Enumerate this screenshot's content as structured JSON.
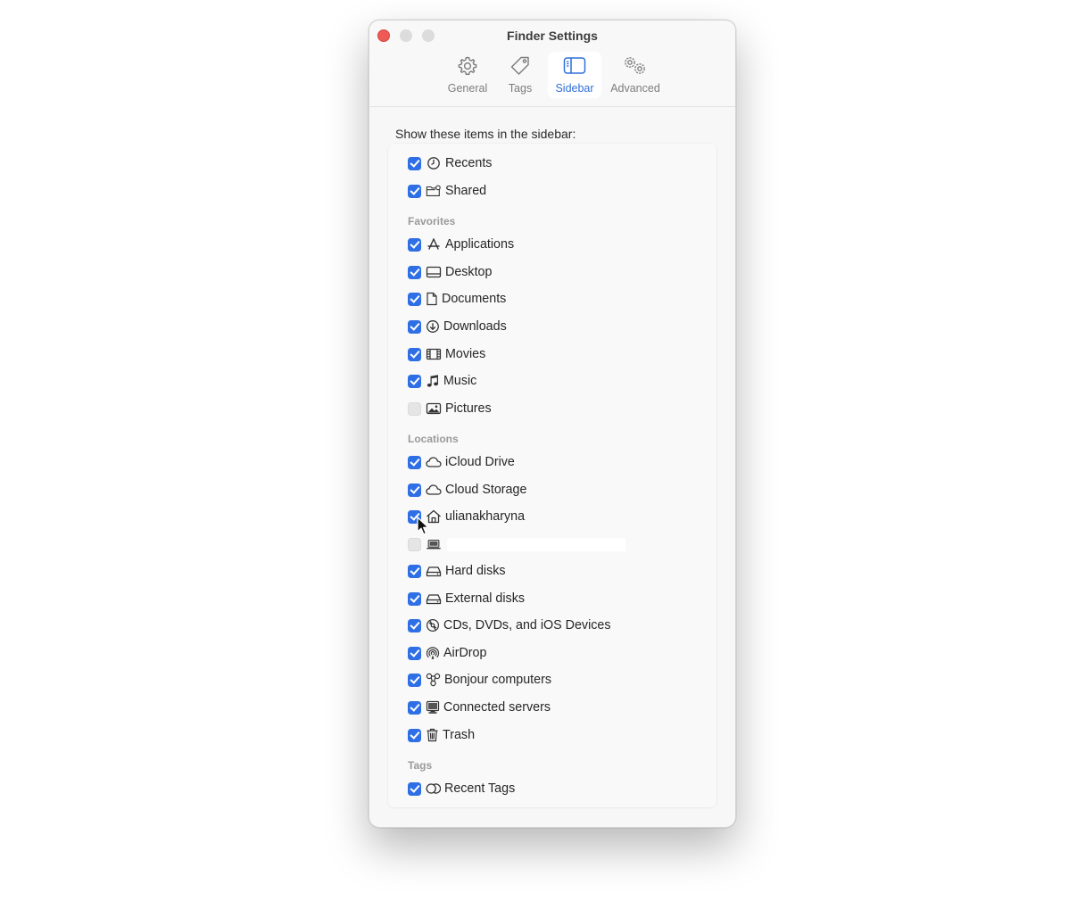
{
  "window": {
    "title": "Finder Settings"
  },
  "toolbar": {
    "tabs": [
      {
        "label": "General",
        "icon": "gear-icon"
      },
      {
        "label": "Tags",
        "icon": "tag-icon"
      },
      {
        "label": "Sidebar",
        "icon": "sidebar-icon",
        "selected": true
      },
      {
        "label": "Advanced",
        "icon": "gears-icon"
      }
    ]
  },
  "heading": "Show these items in the sidebar:",
  "top_items": [
    {
      "label": "Recents",
      "checked": true,
      "icon": "clock-icon"
    },
    {
      "label": "Shared",
      "checked": true,
      "icon": "shared-folder-icon"
    }
  ],
  "sections": {
    "favorites": {
      "title": "Favorites",
      "items": [
        {
          "label": "Applications",
          "checked": true,
          "icon": "applications-icon"
        },
        {
          "label": "Desktop",
          "checked": true,
          "icon": "desktop-icon"
        },
        {
          "label": "Documents",
          "checked": true,
          "icon": "document-icon"
        },
        {
          "label": "Downloads",
          "checked": true,
          "icon": "download-icon"
        },
        {
          "label": "Movies",
          "checked": true,
          "icon": "film-icon"
        },
        {
          "label": "Music",
          "checked": true,
          "icon": "music-note-icon"
        },
        {
          "label": "Pictures",
          "checked": false,
          "icon": "photo-icon"
        }
      ]
    },
    "locations": {
      "title": "Locations",
      "items": [
        {
          "label": "iCloud Drive",
          "checked": true,
          "icon": "cloud-icon"
        },
        {
          "label": "Cloud Storage",
          "checked": true,
          "icon": "cloud-icon"
        },
        {
          "label": "ulianakharyna",
          "checked": true,
          "icon": "home-icon"
        },
        {
          "label": "",
          "checked": false,
          "icon": "laptop-icon",
          "redacted": true
        },
        {
          "label": "Hard disks",
          "checked": true,
          "icon": "hard-disk-icon"
        },
        {
          "label": "External disks",
          "checked": true,
          "icon": "external-disk-icon"
        },
        {
          "label": "CDs, DVDs, and iOS Devices",
          "checked": true,
          "icon": "disc-icon"
        },
        {
          "label": "AirDrop",
          "checked": true,
          "icon": "airdrop-icon"
        },
        {
          "label": "Bonjour computers",
          "checked": true,
          "icon": "bonjour-icon"
        },
        {
          "label": "Connected servers",
          "checked": true,
          "icon": "server-icon"
        },
        {
          "label": "Trash",
          "checked": true,
          "icon": "trash-icon"
        }
      ]
    },
    "tags": {
      "title": "Tags",
      "items": [
        {
          "label": "Recent Tags",
          "checked": true,
          "icon": "tags-circles-icon"
        }
      ]
    }
  },
  "colors": {
    "accent": "#2f6fe6",
    "selected_tab_text": "#2f6fd8",
    "close_button": "#ee5b55"
  }
}
